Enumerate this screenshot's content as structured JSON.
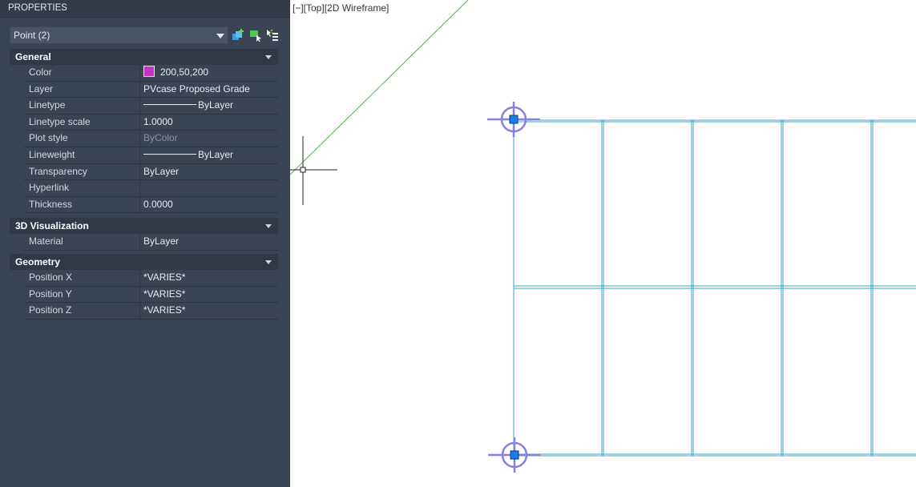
{
  "palette": {
    "title": "PROPERTIES",
    "selection": "Point (2)",
    "tools": [
      "quick-select-icon",
      "select-objects-icon",
      "toggle-pickadd-icon"
    ],
    "sections": {
      "general": {
        "title": "General",
        "rows": [
          {
            "name": "Color",
            "value": "200,50,200"
          },
          {
            "name": "Layer",
            "value": "PVcase Proposed Grade"
          },
          {
            "name": "Linetype",
            "value": "ByLayer"
          },
          {
            "name": "Linetype scale",
            "value": "1.0000"
          },
          {
            "name": "Plot style",
            "value": "ByColor"
          },
          {
            "name": "Lineweight",
            "value": "ByLayer"
          },
          {
            "name": "Transparency",
            "value": "ByLayer"
          },
          {
            "name": "Hyperlink",
            "value": ""
          },
          {
            "name": "Thickness",
            "value": "0.0000"
          }
        ]
      },
      "visualization": {
        "title": "3D Visualization",
        "rows": [
          {
            "name": "Material",
            "value": "ByLayer"
          }
        ]
      },
      "geometry": {
        "title": "Geometry",
        "rows": [
          {
            "name": "Position X",
            "value": "*VARIES*"
          },
          {
            "name": "Position Y",
            "value": "*VARIES*"
          },
          {
            "name": "Position Z",
            "value": "*VARIES*"
          }
        ]
      }
    },
    "colors": {
      "point_color": "#c832c8"
    }
  },
  "viewport": {
    "label": "[−][Top][2D Wireframe]",
    "colors": {
      "grid_line": "#3fa3c4",
      "construction_line": "#45b845",
      "point_marker": "#8a7fe0",
      "grip": "#1a7fe6"
    }
  }
}
